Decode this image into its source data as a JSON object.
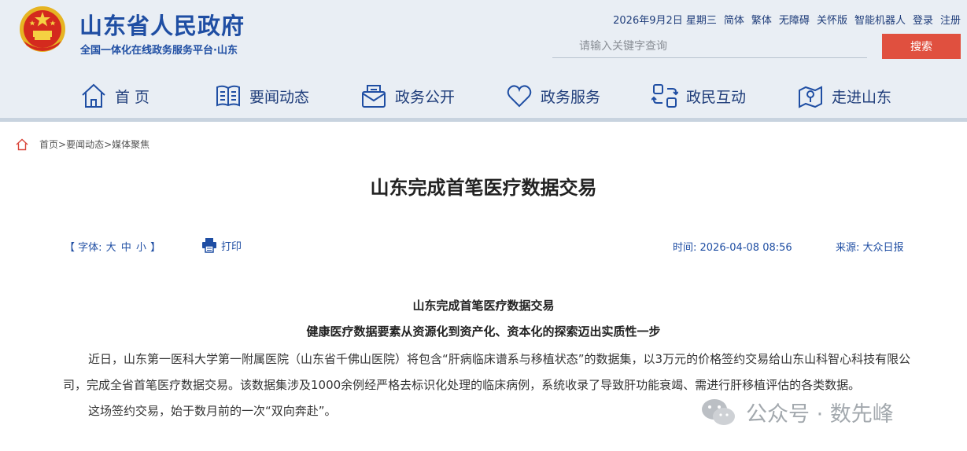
{
  "header": {
    "site_title": "山东省人民政府",
    "site_subtitle": "全国一体化在线政务服务平台·山东",
    "date": "2026年9月2日 星期三",
    "links": [
      "简体",
      "繁体",
      "无障碍",
      "关怀版",
      "智能机器人",
      "登录",
      "注册"
    ],
    "search_placeholder": "请输入关键字查询",
    "search_button": "搜索"
  },
  "nav": [
    {
      "label": "首 页",
      "icon": "home-icon"
    },
    {
      "label": "要闻动态",
      "icon": "book-icon"
    },
    {
      "label": "政务公开",
      "icon": "inbox-icon"
    },
    {
      "label": "政务服务",
      "icon": "heart-icon"
    },
    {
      "label": "政民互动",
      "icon": "interaction-icon"
    },
    {
      "label": "走进山东",
      "icon": "map-pin-icon"
    }
  ],
  "breadcrumb": [
    "首页>",
    "要闻动态>",
    "媒体聚焦"
  ],
  "article": {
    "title": "山东完成首笔医疗数据交易",
    "font_label_open": "【 字体:",
    "font_sizes": [
      "大",
      "中",
      "小"
    ],
    "font_label_close": "】",
    "print_label": "打印",
    "time": "时间: 2026-04-08 08:56",
    "source": "来源: 大众日报",
    "subtitle1": "山东完成首笔医疗数据交易",
    "subtitle2": "健康医疗数据要素从资源化到资产化、资本化的探索迈出实质性一步",
    "paragraphs": [
      "近日，山东第一医科大学第一附属医院（山东省千佛山医院）将包含“肝病临床谱系与移植状态”的数据集，以3万元的价格签约交易给山东山科智心科技有限公司，完成全省首笔医疗数据交易。该数据集涉及1000余例经严格去标识化处理的临床病例，系统收录了导致肝功能衰竭、需进行肝移植评估的各类数据。",
      "这场签约交易，始于数月前的一次“双向奔赴”。"
    ]
  },
  "watermark": "公众号 · 数先峰",
  "colors": {
    "brand_blue": "#1f4ea3",
    "search_red": "#e0503f",
    "header_bg": "#e9eef4"
  }
}
